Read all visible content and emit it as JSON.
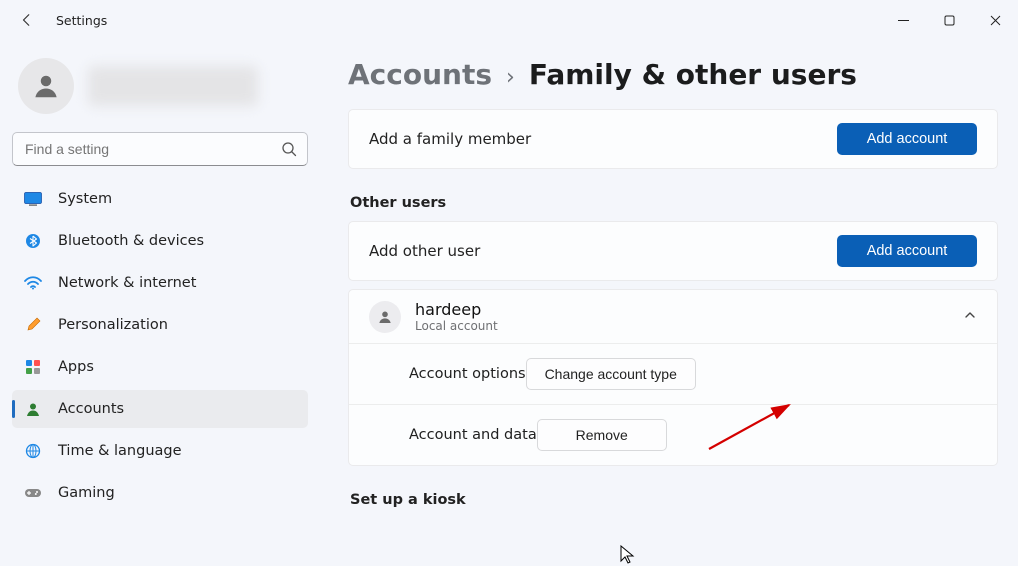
{
  "window": {
    "title": "Settings"
  },
  "search": {
    "placeholder": "Find a setting"
  },
  "nav": {
    "items": [
      {
        "label": "System"
      },
      {
        "label": "Bluetooth & devices"
      },
      {
        "label": "Network & internet"
      },
      {
        "label": "Personalization"
      },
      {
        "label": "Apps"
      },
      {
        "label": "Accounts"
      },
      {
        "label": "Time & language"
      },
      {
        "label": "Gaming"
      }
    ]
  },
  "breadcrumb": {
    "parent": "Accounts",
    "sep": "›",
    "current": "Family & other users"
  },
  "family": {
    "add_label": "Add a family member",
    "add_button": "Add account"
  },
  "other": {
    "header": "Other users",
    "add_label": "Add other user",
    "add_button": "Add account",
    "user": {
      "name": "hardeep",
      "type": "Local account"
    },
    "options": {
      "account_options": "Account options",
      "change_type_button": "Change account type",
      "account_data": "Account and data",
      "remove_button": "Remove"
    }
  },
  "kiosk": {
    "header": "Set up a kiosk"
  }
}
